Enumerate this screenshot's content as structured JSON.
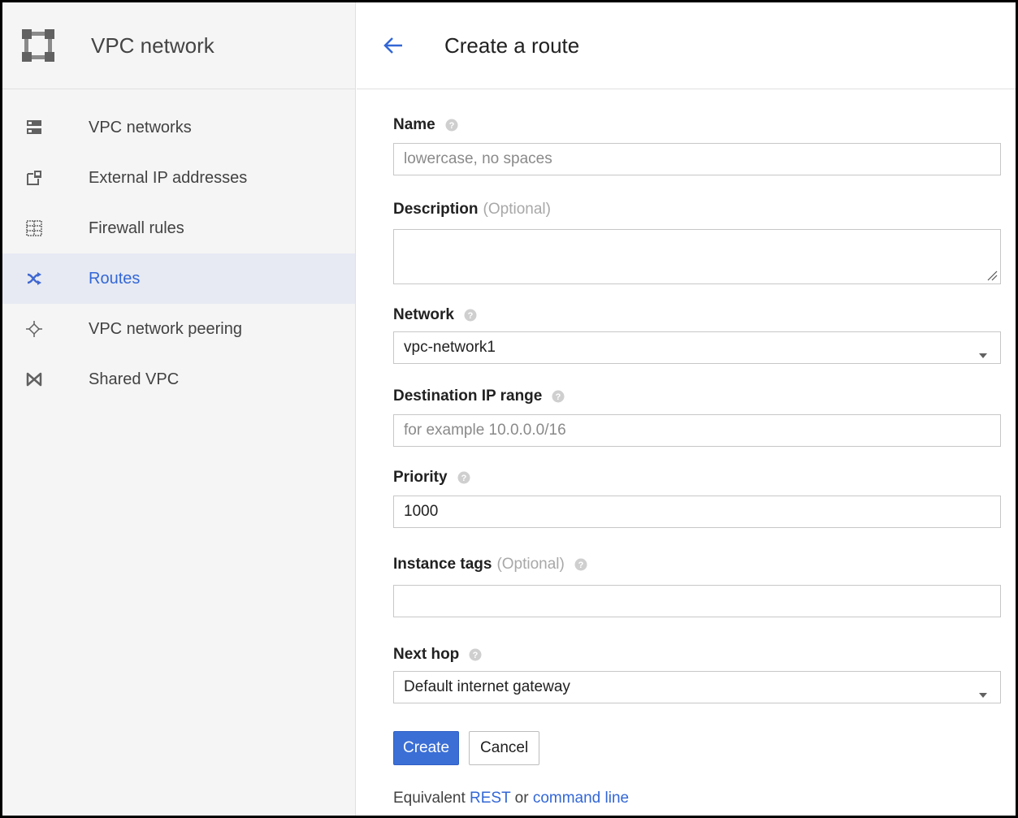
{
  "sidebar": {
    "product_title": "VPC network",
    "product_icon": "vpc-network-icon",
    "items": [
      {
        "label": "VPC networks",
        "icon": "vpc-networks-icon",
        "active": false
      },
      {
        "label": "External IP addresses",
        "icon": "external-ip-icon",
        "active": false
      },
      {
        "label": "Firewall rules",
        "icon": "firewall-icon",
        "active": false
      },
      {
        "label": "Routes",
        "icon": "routes-icon",
        "active": true
      },
      {
        "label": "VPC network peering",
        "icon": "peering-icon",
        "active": false
      },
      {
        "label": "Shared VPC",
        "icon": "shared-vpc-icon",
        "active": false
      }
    ]
  },
  "header": {
    "title": "Create a route",
    "back_icon": "back-arrow-icon"
  },
  "form": {
    "name": {
      "label": "Name",
      "placeholder": "lowercase, no spaces"
    },
    "description": {
      "label": "Description",
      "optional": "(Optional)"
    },
    "network": {
      "label": "Network",
      "value": "vpc-network1"
    },
    "destination": {
      "label": "Destination IP range",
      "placeholder": "for example 10.0.0.0/16"
    },
    "priority": {
      "label": "Priority",
      "value": "1000"
    },
    "instance_tags": {
      "label": "Instance tags",
      "optional": "(Optional)"
    },
    "next_hop": {
      "label": "Next hop",
      "value": "Default internet gateway"
    }
  },
  "actions": {
    "create_label": "Create",
    "cancel_label": "Cancel"
  },
  "footer": {
    "prefix": "Equivalent",
    "rest_link": "REST",
    "or_text": "or",
    "command_link": "command line"
  },
  "colors": {
    "accent": "#3367d6",
    "primary_button": "#3b6fd6",
    "active_nav_bg": "#e7eaf3"
  }
}
